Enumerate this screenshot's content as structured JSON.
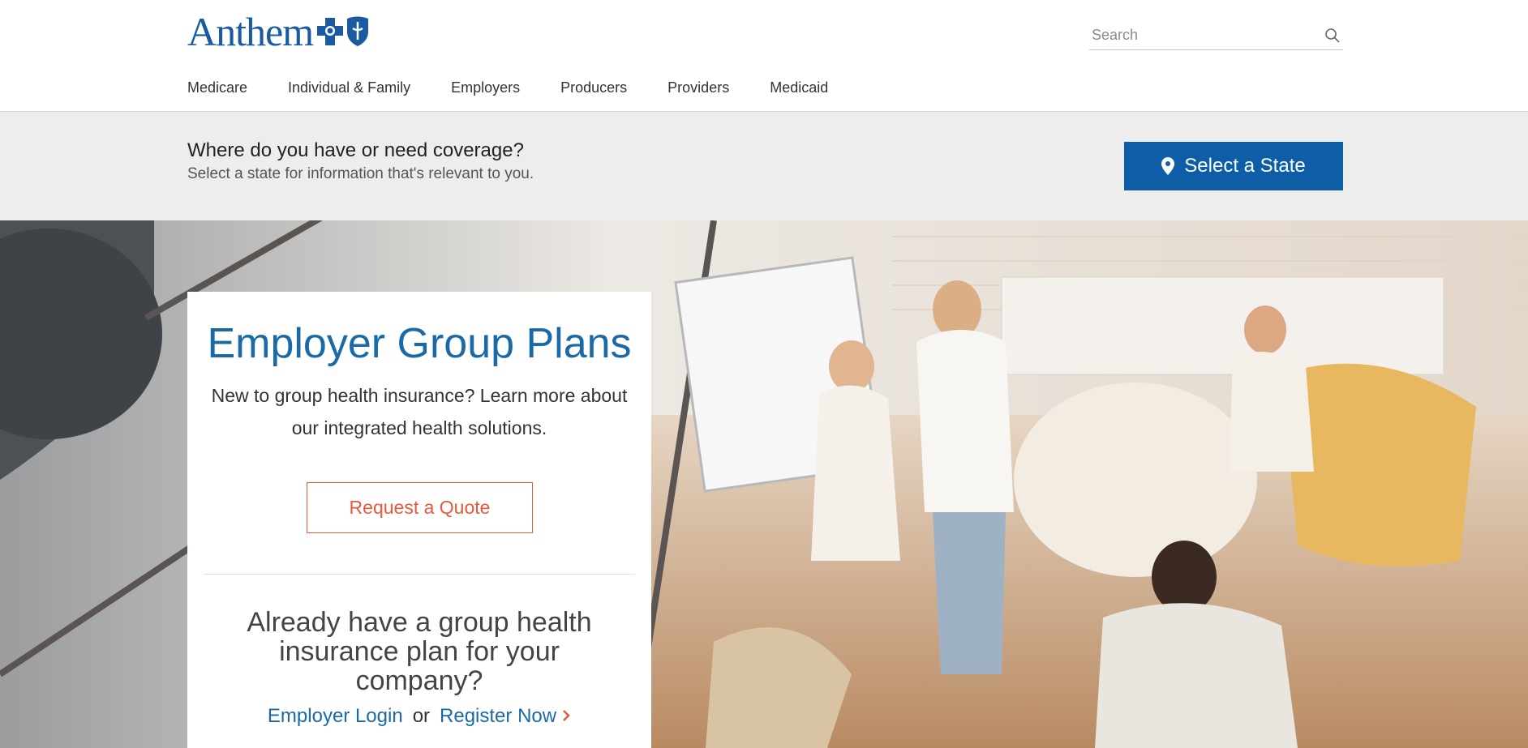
{
  "brand": {
    "name": "Anthem",
    "primary": "#1a5aa0",
    "accent": "#0d5ea6",
    "cta": "#e9583a"
  },
  "search": {
    "placeholder": "Search",
    "icon": "search-icon"
  },
  "nav": {
    "items": [
      {
        "label": "Medicare"
      },
      {
        "label": "Individual & Family"
      },
      {
        "label": "Employers"
      },
      {
        "label": "Producers"
      },
      {
        "label": "Providers"
      },
      {
        "label": "Medicaid"
      }
    ]
  },
  "coverage": {
    "question": "Where do you have or need coverage?",
    "subtitle": "Select a state for information that's relevant to you.",
    "button_label": "Select a State",
    "button_icon": "map-pin-icon"
  },
  "hero": {
    "title": "Employer Group Plans",
    "description": "New to group health insurance? Learn more about our integrated health solutions.",
    "quote_label": "Request a Quote",
    "existing_text": "Already have a group health insurance plan for your company?",
    "login_label": "Employer Login",
    "or_text": "or",
    "register_label": "Register Now",
    "register_icon": "chevron-right-icon"
  }
}
